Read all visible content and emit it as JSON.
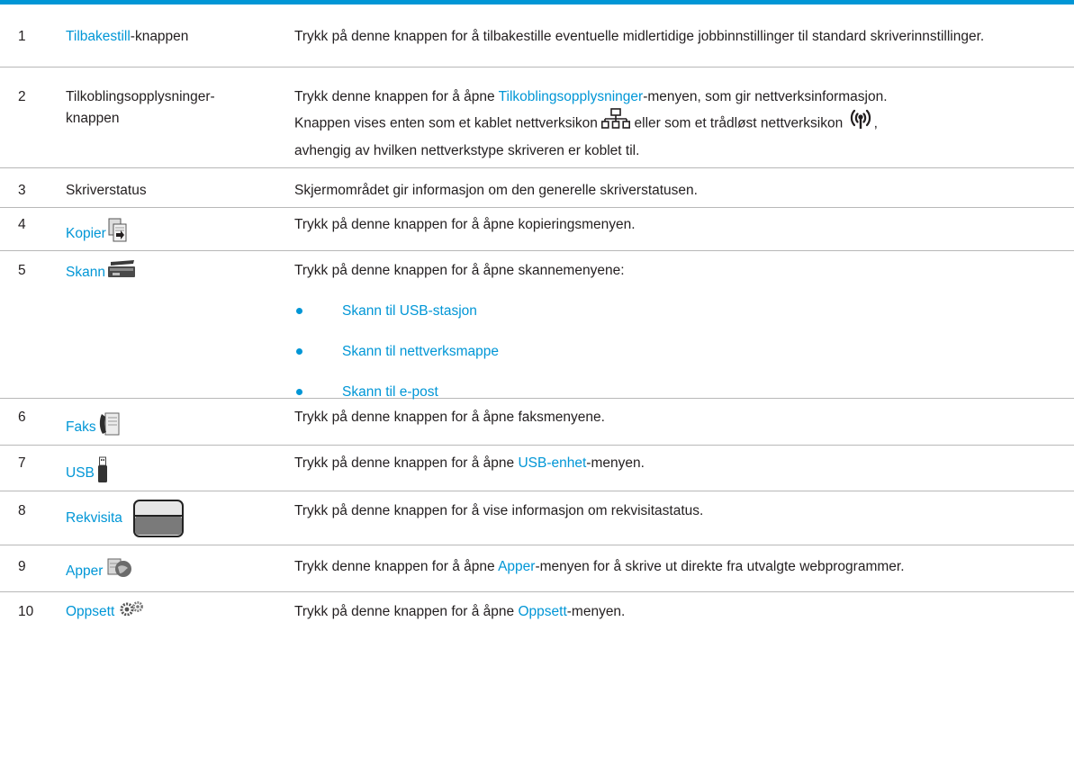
{
  "rows": [
    {
      "num": "1",
      "name_link": "Tilbakestill",
      "name_rest": "-knappen",
      "desc": "Trykk på denne knappen for å tilbakestille eventuelle midlertidige jobbinnstillinger til standard skriverinnstillinger."
    },
    {
      "num": "2",
      "name_line1": "Tilkoblingsopplysninger-",
      "name_line2": "knappen",
      "desc_a": "Trykk denne knappen for å åpne ",
      "desc_link": "Tilkoblingsopplysninger",
      "desc_b": "-menyen, som gir nettverksinformasjon.",
      "desc_c": "Knappen vises enten som et kablet nettverksikon",
      "desc_d": "eller som et trådløst nettverksikon",
      "desc_e": ",",
      "desc_f": "avhengig av hvilken nettverkstype skriveren er koblet til."
    },
    {
      "num": "3",
      "name": "Skriverstatus",
      "desc": "Skjermområdet gir informasjon om den generelle skriverstatusen."
    },
    {
      "num": "4",
      "name": "Kopier",
      "icon": "copy-icon",
      "desc": "Trykk på denne knappen for å åpne kopieringsmenyen."
    },
    {
      "num": "5",
      "name": "Skann",
      "icon": "scan-icon",
      "desc": "Trykk på denne knappen for å åpne skannemenyene:",
      "bullets": [
        "Skann til USB-stasjon",
        "Skann til nettverksmappe",
        "Skann til e-post"
      ]
    },
    {
      "num": "6",
      "name": "Faks",
      "icon": "fax-icon",
      "desc": "Trykk på denne knappen for å åpne faksmenyene."
    },
    {
      "num": "7",
      "name": "USB",
      "icon": "usb-icon",
      "desc_a": "Trykk på denne knappen for å åpne ",
      "desc_link": "USB-enhet",
      "desc_b": "-menyen."
    },
    {
      "num": "8",
      "name": "Rekvisita",
      "icon": "supplies-icon",
      "desc": "Trykk på denne knappen for å vise informasjon om rekvisitastatus."
    },
    {
      "num": "9",
      "name": "Apper",
      "icon": "apps-icon",
      "desc_a": "Trykk denne knappen for å åpne ",
      "desc_link": "Apper",
      "desc_b": "-menyen for å skrive ut direkte fra utvalgte webprogrammer."
    },
    {
      "num": "10",
      "name": "Oppsett",
      "icon": "gear-icon",
      "desc_a": "Trykk på denne knappen for å åpne ",
      "desc_link": "Oppsett",
      "desc_b": "-menyen."
    }
  ],
  "colors": {
    "link": "#0096d6",
    "rule": "#b8b8b8",
    "text": "#231f20"
  }
}
